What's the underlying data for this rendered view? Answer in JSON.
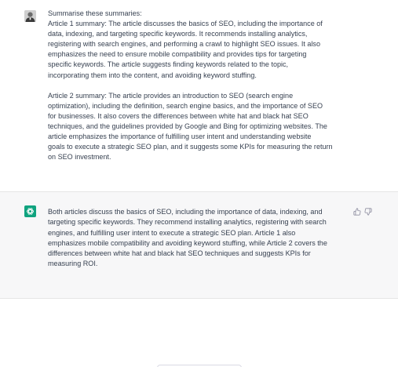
{
  "conversation": {
    "user_message": {
      "lines": [
        "Summarise these summaries:",
        "Article 1 summary: The article discusses the basics of SEO, including the importance of",
        "data, indexing, and targeting specific keywords. It recommends installing analytics,",
        "registering with search engines, and performing a crawl to highlight SEO issues. It also",
        "emphasizes the need to ensure mobile compatibility and provides tips for targeting",
        "specific keywords. The article suggests finding keywords related to the topic,",
        "incorporating them into the content, and avoiding keyword stuffing."
      ],
      "lines2": [
        "Article 2 summary: The article provides an introduction to SEO (search engine",
        "optimization), including the definition, search engine basics, and the importance of SEO",
        "for businesses. It also covers the differences between white hat and black hat SEO",
        "techniques, and the guidelines provided by Google and Bing for optimizing websites. The",
        "article emphasizes the importance of fulfilling user intent and understanding website",
        "goals to execute a strategic SEO plan, and it suggests some KPIs for measuring the return",
        "on SEO investment."
      ]
    },
    "assistant_message": {
      "lines": [
        "Both articles discuss the basics of SEO, including the importance of data, indexing, and",
        "targeting specific keywords. They recommend installing analytics, registering with search",
        "engines, and fulfilling user intent to execute a strategic SEO plan. Article 1 also",
        "emphasizes mobile compatibility and avoiding keyword stuffing, while Article 2 covers the",
        "differences between white hat and black hat SEO techniques and suggests KPIs for",
        "measuring ROI."
      ]
    },
    "icons": {
      "user_avatar": "user-avatar-icon",
      "bot_avatar": "openai-logo-icon",
      "thumbs_up": "thumbs-up-icon",
      "thumbs_down": "thumbs-down-icon"
    },
    "colors": {
      "bot_avatar_bg": "#10a37f",
      "assistant_bg": "#f7f7f8",
      "text": "#374151"
    }
  }
}
